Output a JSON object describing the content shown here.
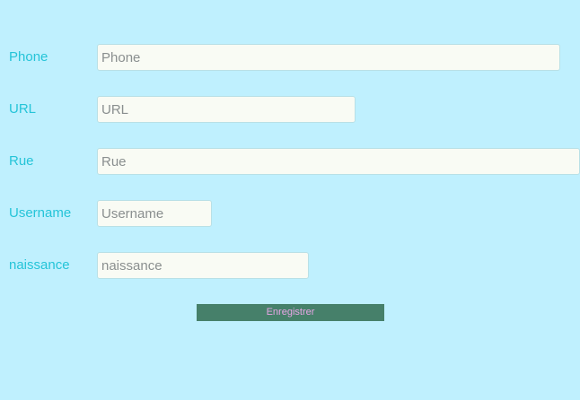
{
  "form": {
    "fields": [
      {
        "label": "Phone",
        "placeholder": "Phone",
        "value": ""
      },
      {
        "label": "URL",
        "placeholder": "URL",
        "value": ""
      },
      {
        "label": "Rue",
        "placeholder": "Rue",
        "value": ""
      },
      {
        "label": "Username",
        "placeholder": "Username",
        "value": ""
      },
      {
        "label": "naissance",
        "placeholder": "naissance",
        "value": ""
      }
    ],
    "submit_label": "Enregistrer"
  },
  "colors": {
    "background": "#bff0fe",
    "label": "#25c4d8",
    "input_background": "#f9fbf4",
    "button_background": "#46806a",
    "button_text": "#e8a6e6"
  }
}
